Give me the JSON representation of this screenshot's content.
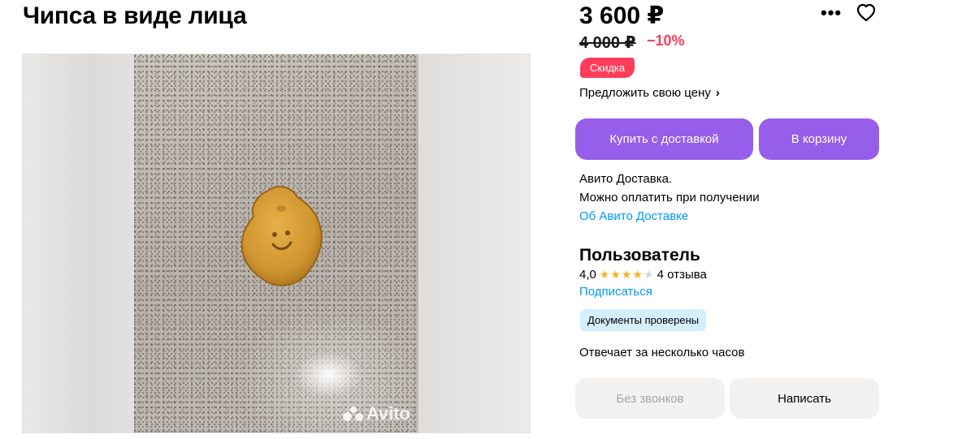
{
  "listing": {
    "title": "Чипса в виде лица",
    "price": "3 600 ₽",
    "old_price": "4 000 ₽",
    "discount": "−10%",
    "sale_badge": "Скидка",
    "offer_price_label": "Предложить свою цену",
    "watermark": "Avito"
  },
  "actions": {
    "buy_with_delivery": "Купить с доставкой",
    "add_to_cart": "В корзину"
  },
  "delivery": {
    "line1": "Авито Доставка.",
    "line2": "Можно оплатить при получении",
    "link": "Об Авито Доставке"
  },
  "seller": {
    "name": "Пользователь",
    "rating": "4,0",
    "stars_filled": 4,
    "stars_total": 5,
    "reviews": "4 отзыва",
    "subscribe": "Подписаться",
    "verified_badge": "Документы проверены",
    "response_time": "Отвечает за несколько часов"
  },
  "contact": {
    "no_calls": "Без звонков",
    "write": "Написать"
  },
  "icons": {
    "more": "more-dots-icon",
    "favorite": "heart-icon"
  },
  "colors": {
    "accent": "#965eeb",
    "sale": "#ff3d5a",
    "link": "#0099f7",
    "star": "#ffb021",
    "verified_bg": "#d6efff"
  }
}
